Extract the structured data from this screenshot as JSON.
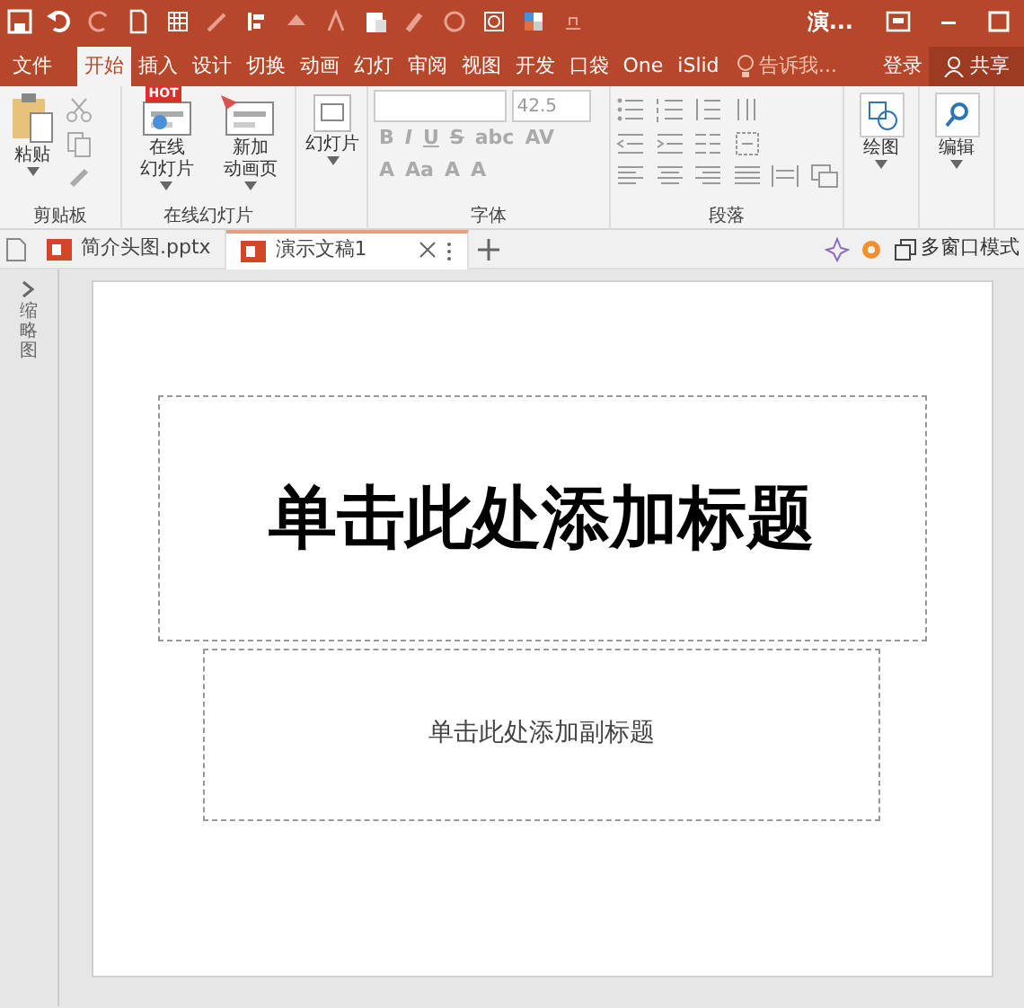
{
  "title_bar": {
    "title": "演..."
  },
  "menu_tabs": [
    {
      "label": "文件",
      "selected": false
    },
    {
      "label": "开始",
      "selected": true
    },
    {
      "label": "插入",
      "selected": false
    },
    {
      "label": "设计",
      "selected": false
    },
    {
      "label": "切换",
      "selected": false
    },
    {
      "label": "动画",
      "selected": false
    },
    {
      "label": "幻灯",
      "selected": false
    },
    {
      "label": "审阅",
      "selected": false
    },
    {
      "label": "视图",
      "selected": false
    },
    {
      "label": "开发",
      "selected": false
    },
    {
      "label": "口袋",
      "selected": false
    },
    {
      "label": "One",
      "selected": false
    },
    {
      "label": "iSlid",
      "selected": false
    }
  ],
  "tell_me": "告诉我...",
  "sign_in": "登录",
  "share": "共享",
  "ribbon": {
    "clipboard": {
      "label": "剪贴板",
      "paste": "粘贴"
    },
    "online": {
      "label": "在线幻灯片",
      "buttons": [
        {
          "lines": [
            "在线",
            "幻灯片"
          ],
          "badge": "HOT"
        },
        {
          "lines": [
            "新加",
            "动画页"
          ]
        }
      ]
    },
    "slides": {
      "button": "幻灯片"
    },
    "font": {
      "label": "字体",
      "disabled": true,
      "font_size": "42.5",
      "row1": [
        "B",
        "I",
        "U",
        "S",
        "abc",
        "AV"
      ],
      "row2": [
        "A",
        "Aa",
        "A",
        "A"
      ]
    },
    "paragraph": {
      "label": "段落"
    },
    "drawing": {
      "button": "绘图"
    },
    "editing": {
      "button": "编辑"
    }
  },
  "doc_tabs": [
    {
      "label": "简介头图.pptx",
      "selected": false
    },
    {
      "label": "演示文稿1",
      "selected": true
    }
  ],
  "multi_window": "多窗口模式",
  "thumbnail_pane": "缩略图",
  "slide": {
    "title": "单击此处添加标题",
    "subtitle": "单击此处添加副标题"
  }
}
